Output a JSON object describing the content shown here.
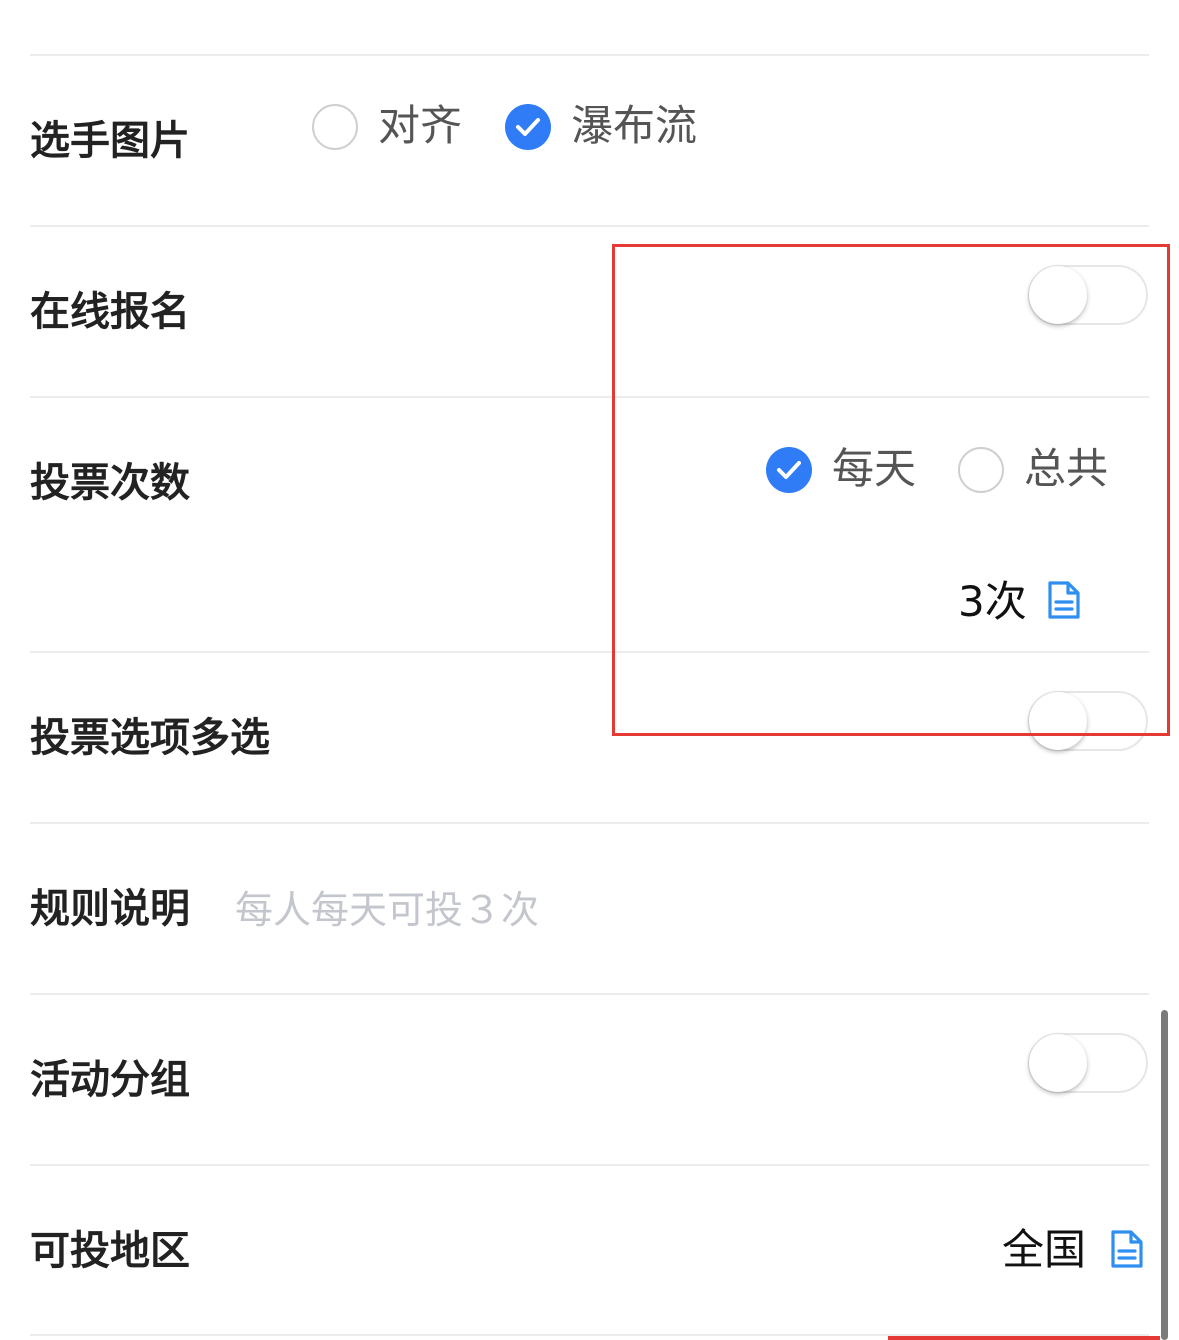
{
  "colors": {
    "accent": "#2f7cf6",
    "highlight_box": "#e53935",
    "placeholder": "#c3c6cc"
  },
  "player_image": {
    "label": "选手图片",
    "options": [
      {
        "label": "对齐",
        "checked": false
      },
      {
        "label": "瀑布流",
        "checked": true
      }
    ]
  },
  "online_signup": {
    "label": "在线报名",
    "enabled": false
  },
  "vote_count": {
    "label": "投票次数",
    "options": [
      {
        "label": "每天",
        "checked": true
      },
      {
        "label": "总共",
        "checked": false
      }
    ],
    "value": "3次",
    "edit_icon": "document-edit-icon"
  },
  "multi_select": {
    "label": "投票选项多选",
    "enabled": false
  },
  "rules": {
    "label": "规则说明",
    "placeholder": "每人每天可投３次"
  },
  "activity_group": {
    "label": "活动分组",
    "enabled": false
  },
  "vote_region": {
    "label": "可投地区",
    "value": "全国",
    "edit_icon": "document-edit-icon"
  }
}
